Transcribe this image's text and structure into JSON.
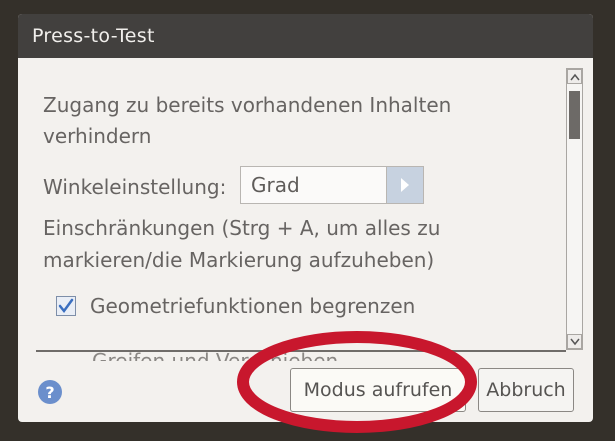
{
  "dialog": {
    "title": "Press-to-Test",
    "intro": "Zugang zu bereits vorhandenen Inhalten verhindern",
    "angle_label": "Winkeleinstellung:",
    "angle_value": "Grad",
    "restrictions": "Einschränkungen (Strg + A, um alles zu markieren/die Markierung aufzuheben)",
    "geometry_option": "Geometriefunktionen begrenzen",
    "geometry_checked": true,
    "next_option_partial": "Greifen und Verschieben",
    "help_label": "?",
    "primary_button": "Modus aufrufen",
    "cancel_button": "Abbruch"
  },
  "colors": {
    "title_bar": "#42403e",
    "dialog_bg": "#f3f1ee",
    "highlight": "#c8172d",
    "help_icon": "#6b8fcc"
  },
  "icons": {
    "dropdown": "chevron-right-icon",
    "checkbox": "checkmark-icon",
    "help": "help-icon",
    "scroll_up": "chevron-up-icon",
    "scroll_down": "chevron-down-icon"
  }
}
